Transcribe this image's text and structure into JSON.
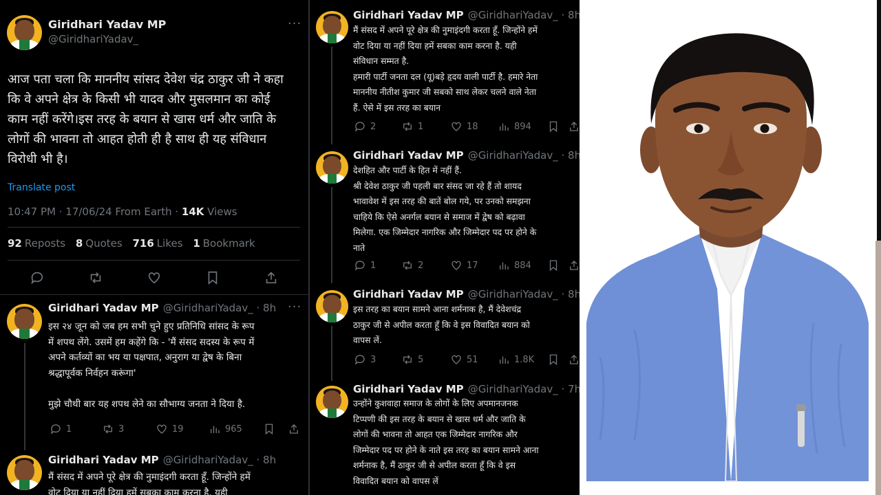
{
  "main_post": {
    "name": "Giridhari Yadav MP",
    "handle": "@GiridhariYadav_",
    "more": "···",
    "text": "आज पता चला कि माननीय सांसद देवेश चंद्र ठाकुर जी ने कहा\nकि वे अपने क्षेत्र के किसी भी यादव और मुसलमान का कोई\nकाम नहीं करेंगे।इस तरह के बयान से खास धर्म और जाति के\nलोगों की भावना तो आहत होती ही है साथ ही यह संविधान\nविरोधी भी है।",
    "translate": "Translate post",
    "timestamp": "10:47 PM · 17/06/24 From Earth · ",
    "views_count": "14K",
    "views_label": " Views",
    "reposts_count": "92",
    "reposts_label": "Reposts",
    "quotes_count": "8",
    "quotes_label": "Quotes",
    "likes_count": "716",
    "likes_label": "Likes",
    "bookmarks_count": "1",
    "bookmarks_label": "Bookmark"
  },
  "left_replies": [
    {
      "name": "Giridhari Yadav MP",
      "handle": "@GiridhariYadav_ · 8h",
      "text": "इस २४ जून को जब हम सभी चुने हुए प्रतिनिधि सांसद के रूप\nमें शपथ लेंगे. उसमें हम कहेंगे कि - 'मैं संसद सदस्य के रूप में\nअपने कर्तव्यों का भय या पक्षपात, अनुराग या द्वेष के बिना\nश्रद्धापूर्वक निर्वहन करूंगा'\n\nमुझे चौथी बार यह शपथ लेने का सौभाग्य जनता ने दिया है.",
      "replies": "1",
      "reposts": "3",
      "likes": "19",
      "views": "965"
    },
    {
      "name": "Giridhari Yadav MP",
      "handle": "@GiridhariYadav_ · 8h",
      "text": "मैं संसद में अपने पूरे क्षेत्र की नुमाइंदगी करता हूँ. जिन्होंने हमें\nवोट दिया या नहीं दिया हमें सबका काम करना है. यही"
    }
  ],
  "mid_replies": [
    {
      "name": "Giridhari Yadav MP",
      "handle": "@GiridhariYadav_ · 8h",
      "text": "मैं संसद में अपने पूरे क्षेत्र की नुमाइंदगी करता हूँ. जिन्होंने हमें\nवोट दिया या नहीं दिया हमें सबका काम करना है. यही\nसंविधान सम्मत है.\nहमारी पार्टी जनता दल (यू)बड़े हृदय वाली पार्टी है. हमारे नेता\nमाननीय नीतीश कुमार जी सबको साथ लेकर चलने वाले नेता\nहैं. ऐसे में इस तरह का बयान",
      "replies": "2",
      "reposts": "1",
      "likes": "18",
      "views": "894"
    },
    {
      "name": "Giridhari Yadav MP",
      "handle": "@GiridhariYadav_ · 8h",
      "text": "देशहित और पार्टी के हित में नहीं हैं.\nश्री देवेश ठाकुर जी पहली बार संसद जा रहे हैं तो शायद\nभावावेश में इस तरह की बातें बोल गये, पर उनको समझना\nचाहिये कि ऐसे अनर्गल बयान से समाज में द्वेष को बढ़ावा\nमिलेगा. एक जिम्मेदार नागरिक और जिम्मेदार पद पर होने के\nनाते",
      "replies": "1",
      "reposts": "2",
      "likes": "17",
      "views": "884"
    },
    {
      "name": "Giridhari Yadav MP",
      "handle": "@GiridhariYadav_ · 8h",
      "text": "इस तरह का बयान सामने आना शर्मनाक है, मैं देवेशचंद्र\nठाकुर जी से अपील करता हूँ कि वे इस विवादित बयान को\nवापस लें.",
      "replies": "3",
      "reposts": "5",
      "likes": "51",
      "views": "1.8K"
    },
    {
      "name": "Giridhari Yadav MP",
      "handle": "@GiridhariYadav_ · 7h",
      "text": "उन्होंने कुशवाहा समाज के लोगों के लिए अपमानजनक\nटिप्पणी की इस तरह के बयान से खास धर्म और जाति के\nलोगों की भावना तो आहत एक जिम्मेदार नागरिक और\nजिम्मेदार पद पर होने के नाते  इस तरह का बयान सामने आना\nशर्मनाक है, मैं ठाकुर जी से अपील करता हूँ कि वे इस\nविवादित बयान को वापस लें"
    }
  ],
  "colors": {
    "background": "#000000",
    "text": "#e7e9ea",
    "muted": "#71767b",
    "link": "#1d9bf0",
    "divider": "#2f3336"
  },
  "photo": {
    "subject": "portrait-photo",
    "vest_color": "#6f8fd6",
    "shirt_color": "#f2f2f2",
    "background": "#ffffff"
  }
}
